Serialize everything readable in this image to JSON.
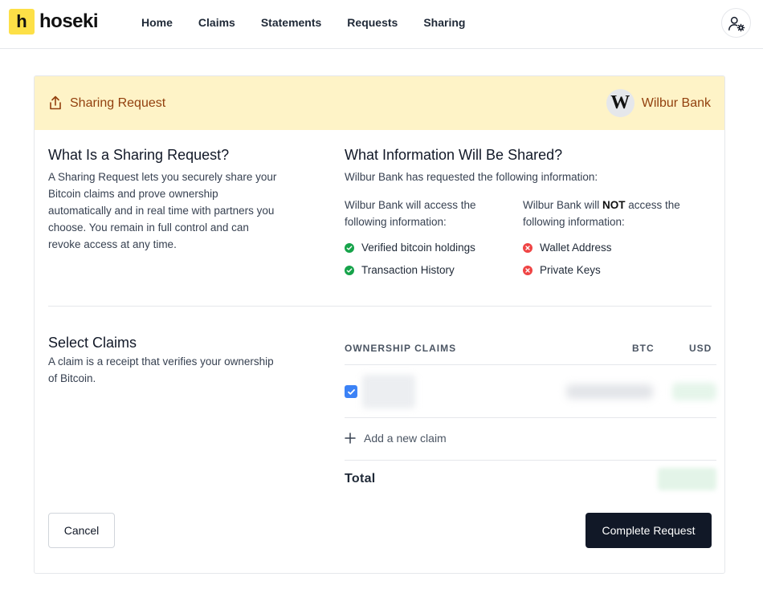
{
  "app": {
    "logo_letter": "h",
    "logo_text": "hoseki",
    "brand_color": "#fde047"
  },
  "nav": {
    "items": [
      {
        "label": "Home"
      },
      {
        "label": "Claims"
      },
      {
        "label": "Statements"
      },
      {
        "label": "Requests"
      },
      {
        "label": "Sharing"
      }
    ],
    "user_icon": "user-settings-icon"
  },
  "request": {
    "header_title": "Sharing Request",
    "header_icon": "share-upload-icon",
    "bank_logo_letter": "W",
    "bank_name": "Wilbur Bank",
    "header_bg": "#fef3c7",
    "header_text_color": "#92400e"
  },
  "what": {
    "title": "What Is a Sharing Request?",
    "description": "A Sharing Request lets you securely share your Bitcoin claims and prove ownership automatically and in real time with partners you choose. You remain in full control and can revoke access at any time."
  },
  "info": {
    "title": "What Information Will Be Shared?",
    "subtitle": "Wilbur Bank has requested the following information:",
    "access_heading": "Wilbur Bank will access the following information:",
    "noaccess_prefix": "Wilbur Bank will ",
    "noaccess_emphasis": "NOT",
    "noaccess_suffix": " access the following information:",
    "access_items": [
      {
        "label": "Verified bitcoin holdings",
        "icon": "check-circle-icon"
      },
      {
        "label": "Transaction History",
        "icon": "check-circle-icon"
      }
    ],
    "noaccess_items": [
      {
        "label": "Wallet Address",
        "icon": "x-circle-icon"
      },
      {
        "label": "Private Keys",
        "icon": "x-circle-icon"
      }
    ]
  },
  "claims": {
    "title": "Select Claims",
    "description": "A claim is a receipt that verifies your ownership of Bitcoin.",
    "columns": {
      "name": "OWNERSHIP CLAIMS",
      "btc": "BTC",
      "usd": "USD"
    },
    "rows": [
      {
        "checked": true
      }
    ],
    "add_label": "Add a new claim",
    "total_label": "Total"
  },
  "actions": {
    "cancel_label": "Cancel",
    "complete_label": "Complete Request"
  }
}
